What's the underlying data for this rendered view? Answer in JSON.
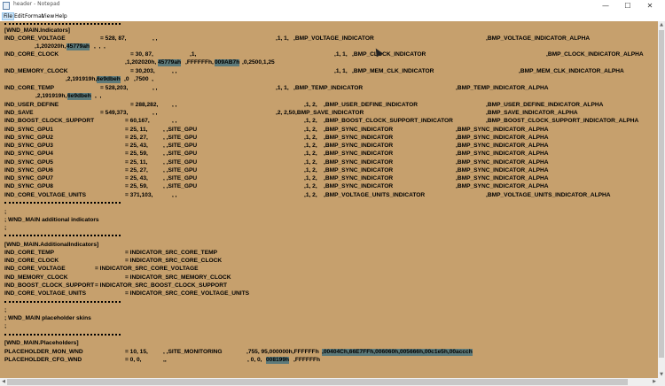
{
  "window": {
    "title": "header - Notepad",
    "minimize_glyph": "—",
    "maximize_glyph": "☐",
    "close_glyph": "✕",
    "icon": "notepad-icon"
  },
  "menu": [
    "File",
    "Edit",
    "Format",
    "View",
    "Help"
  ],
  "colors": {
    "editor_bg": "#c6a06d",
    "highlight": "#5d7a7a"
  },
  "doc": {
    "h_indicators": "[WND_MAIN.Indicators]",
    "r1a": "IND_CORE_VOLTAGE",
    "r1b": "= 528, 87,",
    "r1c": ", ,",
    "r1d": ",1, 1,",
    "r1e": ",BMP_VOLTAGE_INDICATOR",
    "r1f": ",BMP_VOLTAGE_INDICATOR_ALPHA",
    "r2a": ",1,202020h,",
    "r2b": "45779ah",
    "r2c": ",  ,  ,",
    "r3a": "IND_CORE_CLOCK",
    "r3b": "= 30, 87,",
    "r3c": ",1,",
    "r3d": ",1, 1,",
    "r3e": ",BMP_CLOCK_INDICATOR",
    "r3f": ",BMP_CLOCK_INDICATOR_ALPHA",
    "r4a": ",1,202020h,",
    "r4b": "45779ah",
    "r4c": ",FFFFFFh,",
    "r4d": "009AB7h",
    "r4e": ",0,2500,1,25",
    "r5a": "IND_MEMORY_CLOCK",
    "r5b": "= 30,203,",
    "r5c": ", ,",
    "r5d": ",1, 1,",
    "r5e": ",BMP_MEM_CLK_INDICATOR",
    "r5f": ",BMP_MEM_CLK_INDICATOR_ALPHA",
    "r6a": ",2,191919h,",
    "r6b": "6e9dbeh",
    "r6c": ",0   ,7500  ,",
    "r7a": "IND_CORE_TEMP",
    "r7b": "= 528,203,",
    "r7c": ", ,",
    "r7d": ",1, 1,",
    "r7e": ",BMP_TEMP_INDICATOR",
    "r7f": ",BMP_TEMP_INDICATOR_ALPHA",
    "r8a": ",2,191919h,",
    "r8b": "6e9dbeh",
    "r8c": ",  ,",
    "r9a": "IND_USER_DEFINE",
    "r9b": "= 288,282,",
    "r9c": ", ,",
    "r9d": ",1, 2,",
    "r9e": ",BMP_USER_DEFINE_INDICATOR",
    "r9f": ",BMP_USER_DEFINE_INDICATOR_ALPHA",
    "r10a": "IND_SAVE",
    "r10b": "= 549,373,",
    "r10c": ", ,",
    "r10d": ",2, 2,50,BMP_SAVE_INDICATOR",
    "r10f": ",BMP_SAVE_INDICATOR_ALPHA",
    "r11a": "IND_BOOST_CLOCK_SUPPORT",
    "r11b": "= 60,167,",
    "r11c": ", ,",
    "r11d": ",1, 2,",
    "r11e": ",BMP_BOOST_CLOCK_SUPPORT_INDICATOR",
    "r11f": ",BMP_BOOST_CLOCK_SUPPORT_INDICATOR_ALPHA",
    "g1a": "IND_SYNC_GPU1",
    "g1b": "= 25, 11,",
    "g2a": "IND_SYNC_GPU2",
    "g2b": "= 25, 27,",
    "g3a": "IND_SYNC_GPU3",
    "g3b": "= 25, 43,",
    "g4a": "IND_SYNC_GPU4",
    "g4b": "= 25, 59,",
    "g5a": "IND_SYNC_GPU5",
    "g5b": "= 25, 11,",
    "g6a": "IND_SYNC_GPU6",
    "g6b": "= 25, 27,",
    "g7a": "IND_SYNC_GPU7",
    "g7b": "= 25, 43,",
    "g8a": "IND_SYNC_GPU8",
    "g8b": "= 25, 59,",
    "gsite": ", ,SITE_GPU",
    "g12": ",1, 2,",
    "gbmp": ",BMP_SYNC_INDICATOR",
    "galpha": ",BMP_SYNC_INDICATOR_ALPHA",
    "r12a": "IND_CORE_VOLTAGE_UNITS",
    "r12b": "= 371,103,",
    "r12c": ", ,",
    "r12d": ",1, 2,",
    "r12e": ",BMP_VOLTAGE_UNITS_INDICATOR",
    "r12f": ",BMP_VOLTAGE_UNITS_INDICATOR_ALPHA",
    "semi": ";",
    "c_additional": "; WND_MAIN additional indicators",
    "h_additional": "[WND_MAIN.AdditionalIndicators]",
    "a1a": "IND_CORE_TEMP",
    "a1b": "= INDICATOR_SRC_CORE_TEMP",
    "a2a": "IND_CORE_CLOCK",
    "a2b": "= INDICATOR_SRC_CORE_CLOCK",
    "a3a": "IND_CORE_VOLTAGE",
    "a3b": "= INDICATOR_SRC_CORE_VOLTAGE",
    "a4a": "IND_MEMORY_CLOCK",
    "a4b": "= INDICATOR_SRC_MEMORY_CLOCK",
    "a5a": "IND_BOOST_CLOCK_SUPPORT",
    "a5b": "= INDICATOR_SRC_BOOST_CLOCK_SUPPORT",
    "a6a": "IND_CORE_VOLTAGE_UNITS",
    "a6b": "= INDICATOR_SRC_CORE_VOLTAGE_UNITS",
    "c_placeholder": "; WND_MAIN placeholder skins",
    "h_placeholders": "[WND_MAIN.Placeholders]",
    "p1a": "PLACEHOLDER_MON_WND",
    "p1b": "= 10, 15,",
    "p1c": ", ,SITE_MONITORING",
    "p1d": ",755, 95,000000h,FFFFFFh",
    "p1e": ",00404Ch,66E7FFh,006060h,005666h,00c1e5h,00accch",
    "p2a": "PLACEHOLDER_CFG_WND",
    "p2b": "= 0, 0,",
    "p2c": ",,",
    "p2d": ", 0, 0,",
    "p2e": "008199h",
    "p2f": ",FFFFFFh"
  }
}
